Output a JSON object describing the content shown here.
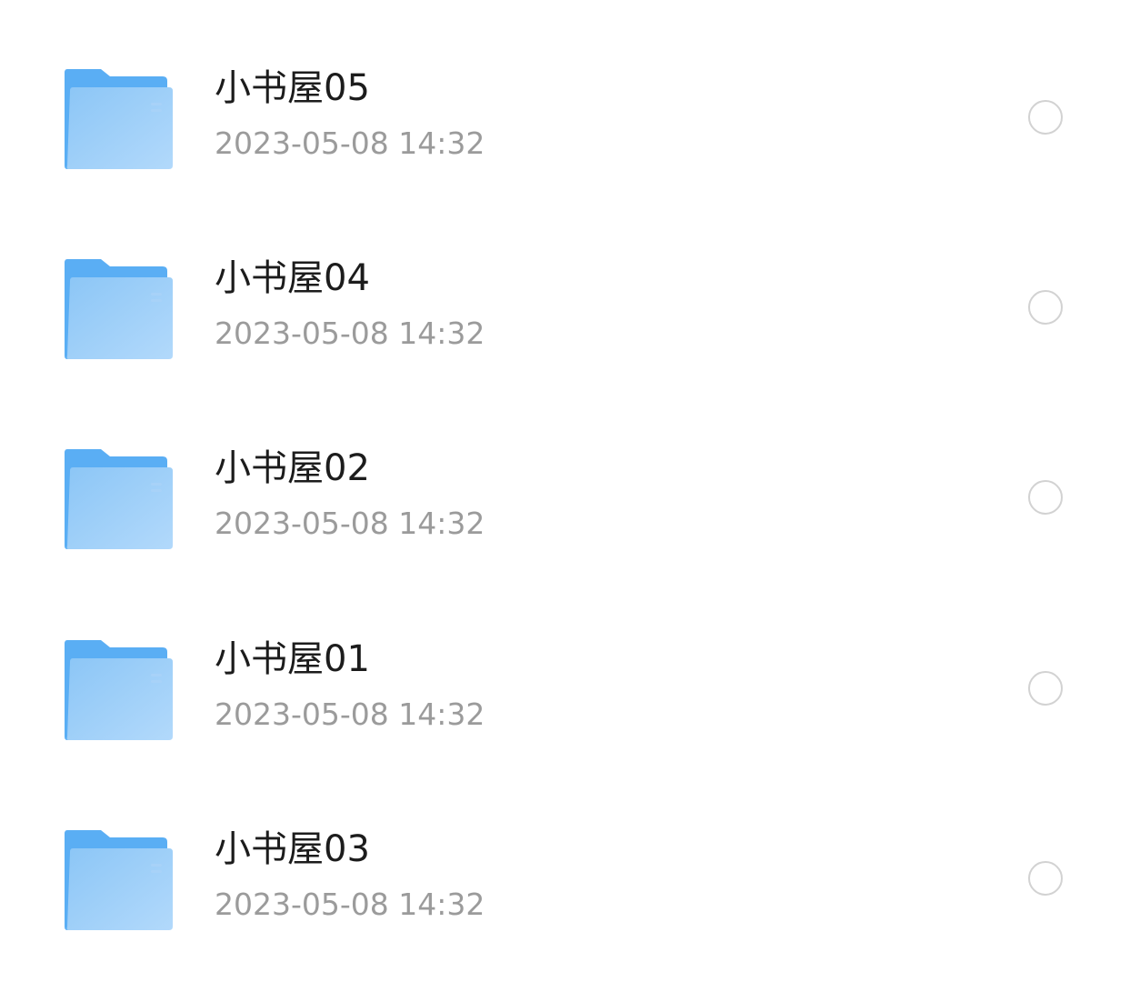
{
  "colors": {
    "folder_tab": "#5aaef4",
    "folder_back": "#5aaef4",
    "folder_front_top": "#8cc6f6",
    "folder_front_bottom": "#b2d9fb",
    "title_text": "#1c1c1c",
    "date_text": "#9b9b9b",
    "radio_border": "#d2d2d2"
  },
  "files": [
    {
      "icon": "folder-icon",
      "name": "小书屋05",
      "date": "2023-05-08 14:32",
      "selected": false
    },
    {
      "icon": "folder-icon",
      "name": "小书屋04",
      "date": "2023-05-08 14:32",
      "selected": false
    },
    {
      "icon": "folder-icon",
      "name": "小书屋02",
      "date": "2023-05-08 14:32",
      "selected": false
    },
    {
      "icon": "folder-icon",
      "name": "小书屋01",
      "date": "2023-05-08 14:32",
      "selected": false
    },
    {
      "icon": "folder-icon",
      "name": "小书屋03",
      "date": "2023-05-08 14:32",
      "selected": false
    }
  ]
}
